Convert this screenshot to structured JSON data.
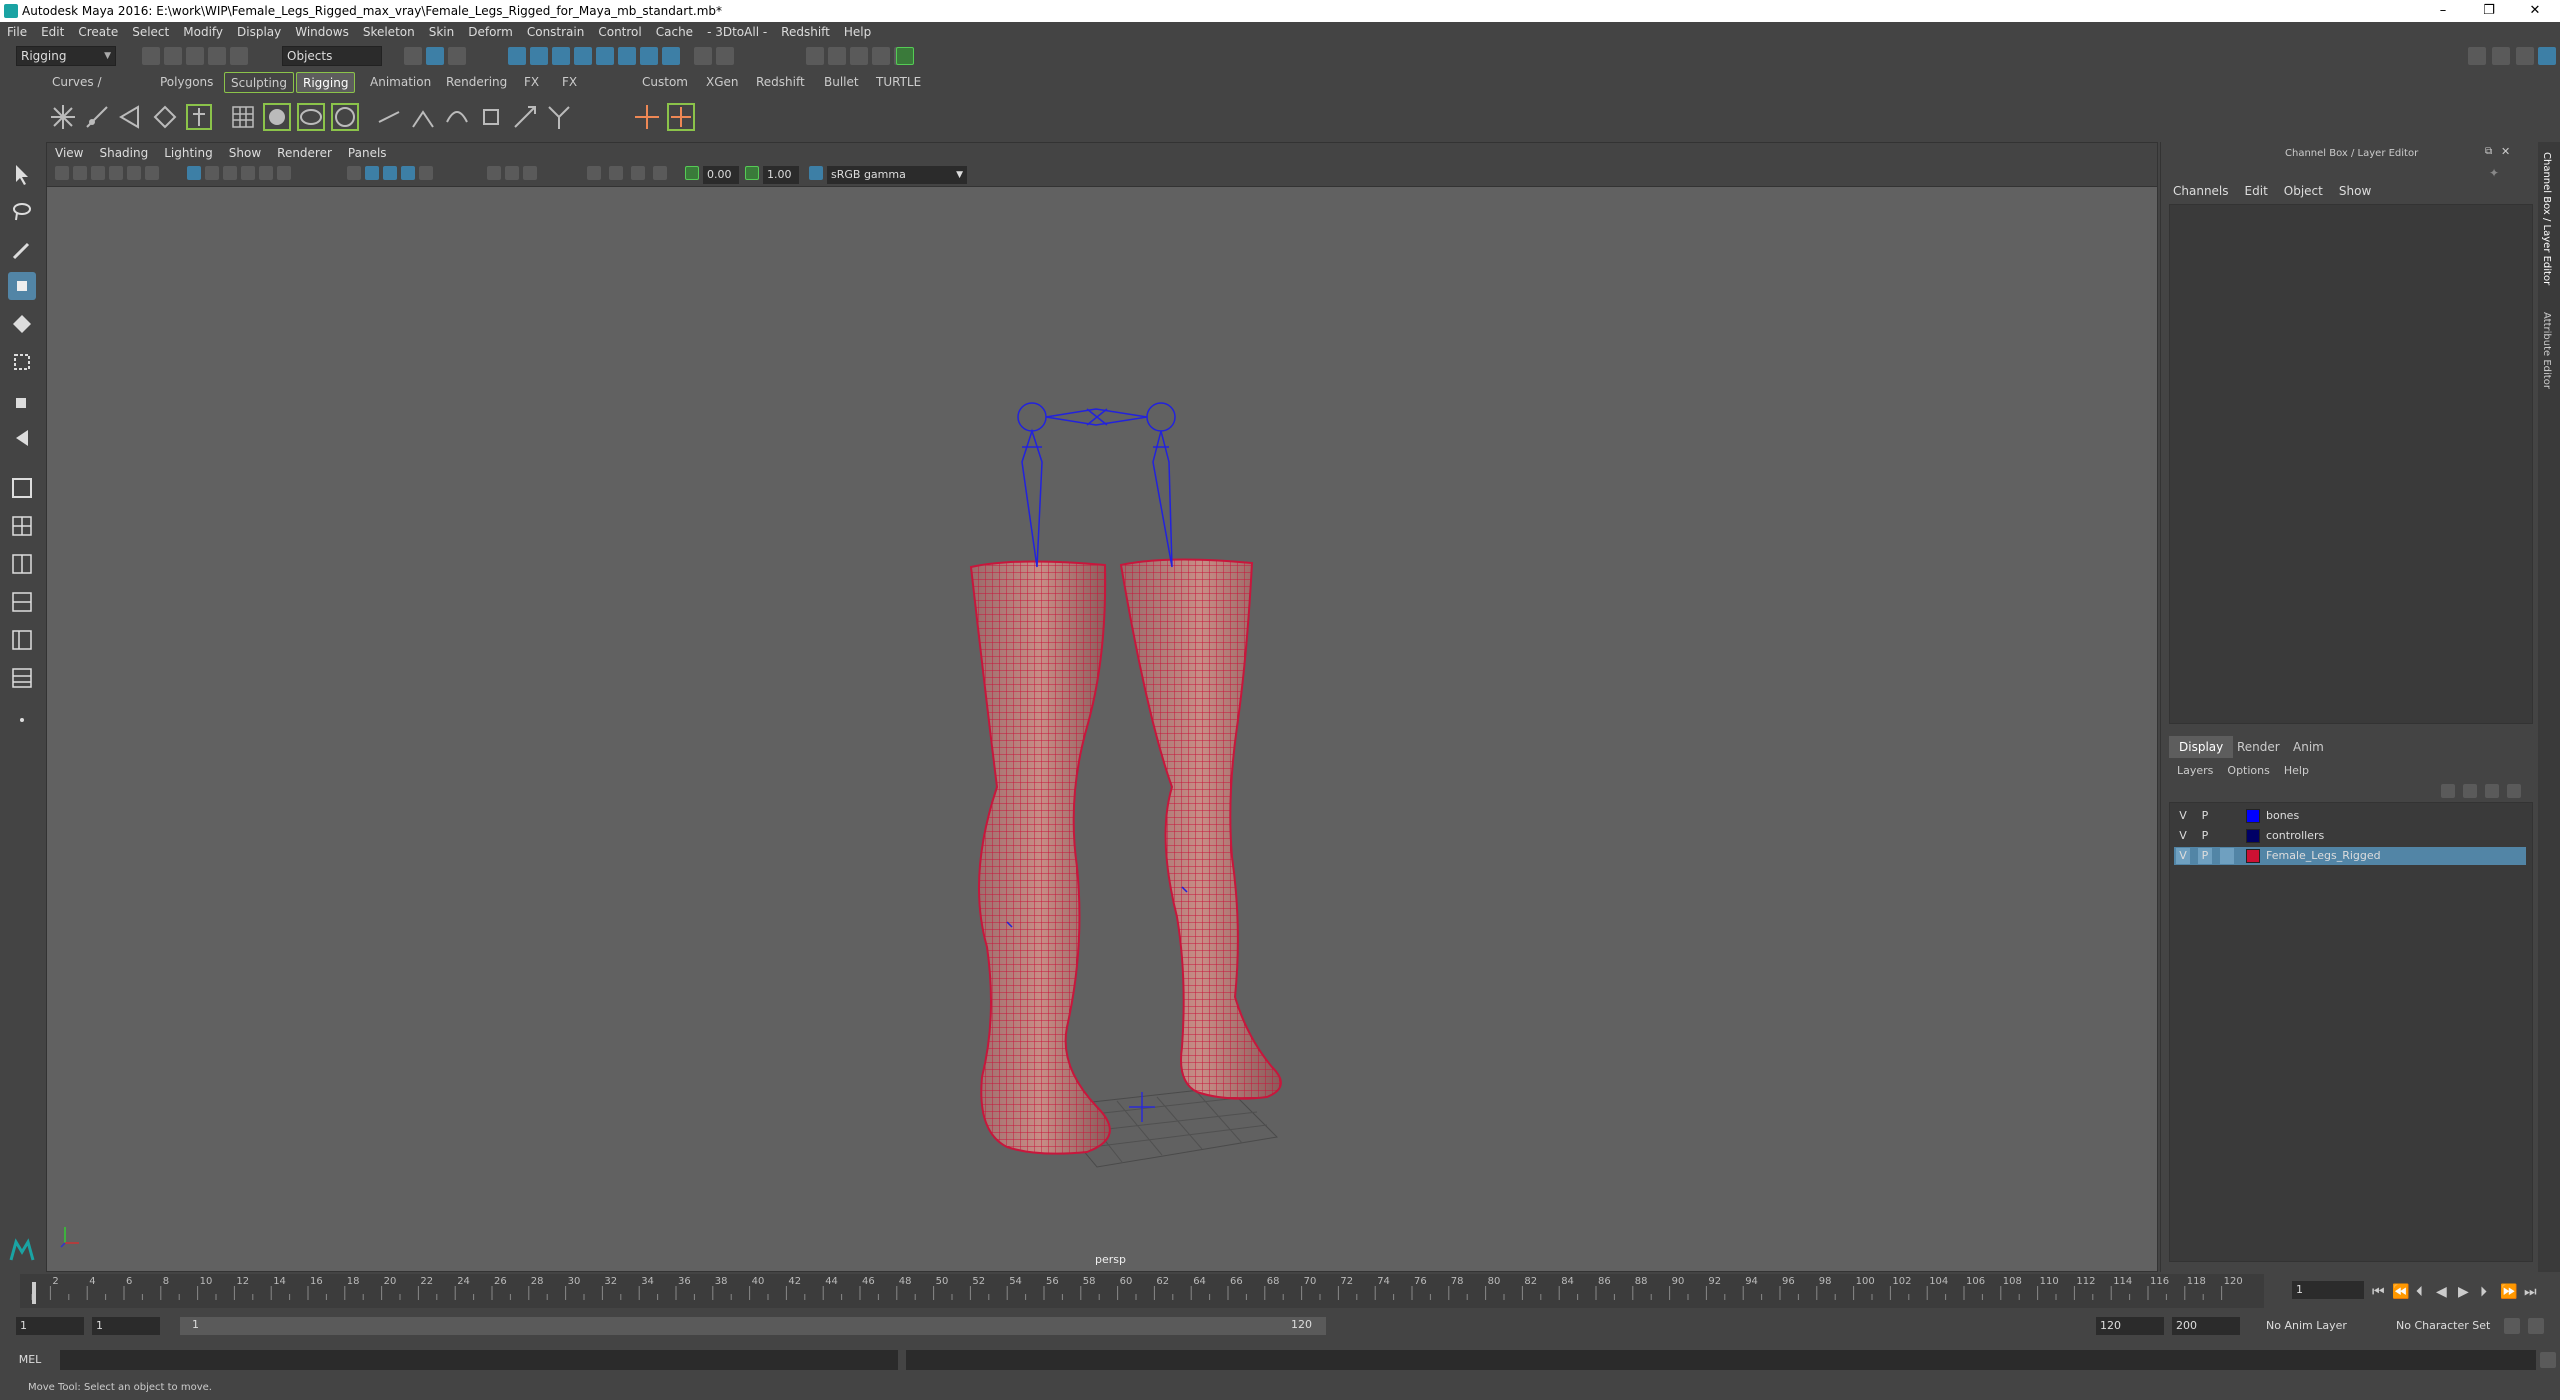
{
  "title_bar": {
    "title": "Autodesk Maya 2016: E:\\work\\WIP\\Female_Legs_Rigged_max_vray\\Female_Legs_Rigged_for_Maya_mb_standart.mb*",
    "minimize": "–",
    "maximize": "❐",
    "close": "✕"
  },
  "menu": [
    "File",
    "Edit",
    "Create",
    "Select",
    "Modify",
    "Display",
    "Windows",
    "Skeleton",
    "Skin",
    "Deform",
    "Constrain",
    "Control",
    "Cache",
    "- 3DtoAll -",
    "Redshift",
    "Help"
  ],
  "status_line": {
    "menu_set": "Rigging",
    "selection_mode": "Objects"
  },
  "shelf_tabs": [
    "Curves / Surfaces",
    "Polygons",
    "Sculpting",
    "Rigging",
    "Animation",
    "Rendering",
    "FX",
    "FX Caching",
    "Custom",
    "XGen",
    "Redshift",
    "Bullet",
    "TURTLE"
  ],
  "shelf_active": "Rigging",
  "viewport": {
    "menu": [
      "View",
      "Shading",
      "Lighting",
      "Show",
      "Renderer",
      "Panels"
    ],
    "exposure": "0.00",
    "gamma": "1.00",
    "color_space": "sRGB gamma",
    "camera_label": "persp"
  },
  "channel_box": {
    "title": "Channel Box / Layer Editor",
    "menu": [
      "Channels",
      "Edit",
      "Object",
      "Show"
    ]
  },
  "layer_editor": {
    "tabs": [
      "Display",
      "Render",
      "Anim"
    ],
    "menu": [
      "Layers",
      "Options",
      "Help"
    ],
    "layers": [
      {
        "v": "V",
        "p": "P",
        "name": "bones",
        "color": "#0000ff"
      },
      {
        "v": "V",
        "p": "P",
        "name": "controllers",
        "color": "#000066"
      },
      {
        "v": "V",
        "p": "P",
        "name": "Female_Legs_Rigged",
        "color": "#cc1133"
      }
    ]
  },
  "side_tabs": [
    "Channel Box / Layer Editor",
    "Attribute Editor"
  ],
  "time_slider": {
    "ticks": [
      "2",
      "4",
      "6",
      "8",
      "10",
      "12",
      "14",
      "16",
      "18",
      "20",
      "22",
      "24",
      "26",
      "28",
      "30",
      "32",
      "34",
      "36",
      "38",
      "40",
      "42",
      "44",
      "46",
      "48",
      "50",
      "52",
      "54",
      "56",
      "58",
      "60",
      "62",
      "64",
      "66",
      "68",
      "70",
      "72",
      "74",
      "76",
      "78",
      "80",
      "82",
      "84",
      "86",
      "88",
      "90",
      "92",
      "94",
      "96",
      "98",
      "100",
      "102",
      "104",
      "106",
      "108",
      "110",
      "112",
      "114",
      "116",
      "118",
      "120"
    ],
    "current_frame": "1"
  },
  "range_slider": {
    "start": "1",
    "inner_start": "1",
    "range_start": "1",
    "range_end": "120",
    "end": "120",
    "outer_end": "200",
    "anim_layer": "No Anim Layer",
    "character_set": "No Character Set"
  },
  "command_line": {
    "label": "MEL"
  },
  "help_line": "Move Tool: Select an object to move."
}
